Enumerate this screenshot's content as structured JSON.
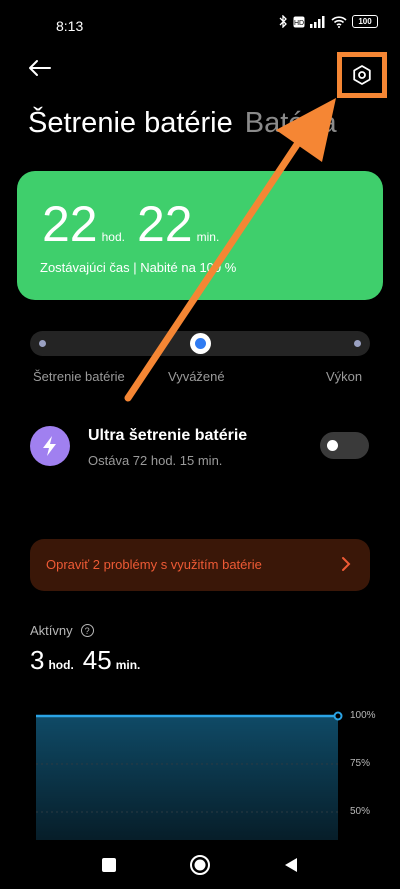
{
  "status_bar": {
    "time": "8:13",
    "battery": "100"
  },
  "header": {
    "title": "Šetrenie batérie",
    "title_secondary": "Batéria"
  },
  "battery_card": {
    "hours_value": "22",
    "hours_unit": "hod.",
    "minutes_value": "22",
    "minutes_unit": "min.",
    "remaining_text": "Zostávajúci čas | Nabité na 100 %",
    "color": "#3fcf6c"
  },
  "mode_slider": {
    "labels": [
      "Šetrenie batérie",
      "Vyvážené",
      "Výkon"
    ],
    "selected": "Vyvážené",
    "accent": "#2f7bf2"
  },
  "ultra_saver": {
    "title": "Ultra šetrenie batérie",
    "subtitle": "Ostáva 72 hod. 15 min.",
    "enabled": false,
    "icon": "lightning-icon"
  },
  "fix_banner": {
    "text": "Opraviť 2 problémy s využitím batérie",
    "color": "#ee5a35"
  },
  "active_usage": {
    "label": "Aktívny",
    "hours_value": "3",
    "hours_unit": "hod.",
    "minutes_value": "45",
    "minutes_unit": "min."
  },
  "chart_data": {
    "type": "area",
    "y_tick_labels": [
      "100%",
      "75%",
      "50%"
    ],
    "ylim": [
      50,
      100
    ],
    "x": [
      0,
      1
    ],
    "values": [
      100,
      100
    ],
    "grid": true
  },
  "annotation": {
    "highlight_color": "#f58634"
  }
}
